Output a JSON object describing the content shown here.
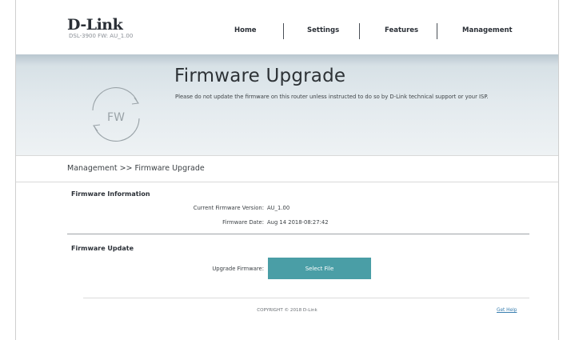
{
  "header": {
    "logo": "D-Link",
    "model_info": "DSL-3900  FW: AU_1.00",
    "nav": [
      "Home",
      "Settings",
      "Features",
      "Management"
    ]
  },
  "banner": {
    "icon_text": "FW",
    "title": "Firmware Upgrade",
    "description": "Please do not update the firmware on this router unless instructed to do so by D-Link technical support or your ISP."
  },
  "breadcrumb": "Management >> Firmware Upgrade",
  "firmware_info": {
    "title": "Firmware Information",
    "version_label": "Current Firmware Version:",
    "version_value": "AU_1.00",
    "date_label": "Firmware Date:",
    "date_value": "Aug 14 2018-08:27:42"
  },
  "firmware_update": {
    "title": "Firmware Update",
    "upgrade_label": "Upgrade Firmware:",
    "select_button": "Select File"
  },
  "footer": {
    "copyright": "COPYRIGHT © 2018 D-Link",
    "help_link": "Get Help"
  },
  "colors": {
    "accent": "#4a9ea6",
    "link": "#3a7fb0",
    "text_dark": "#2a2f36"
  }
}
